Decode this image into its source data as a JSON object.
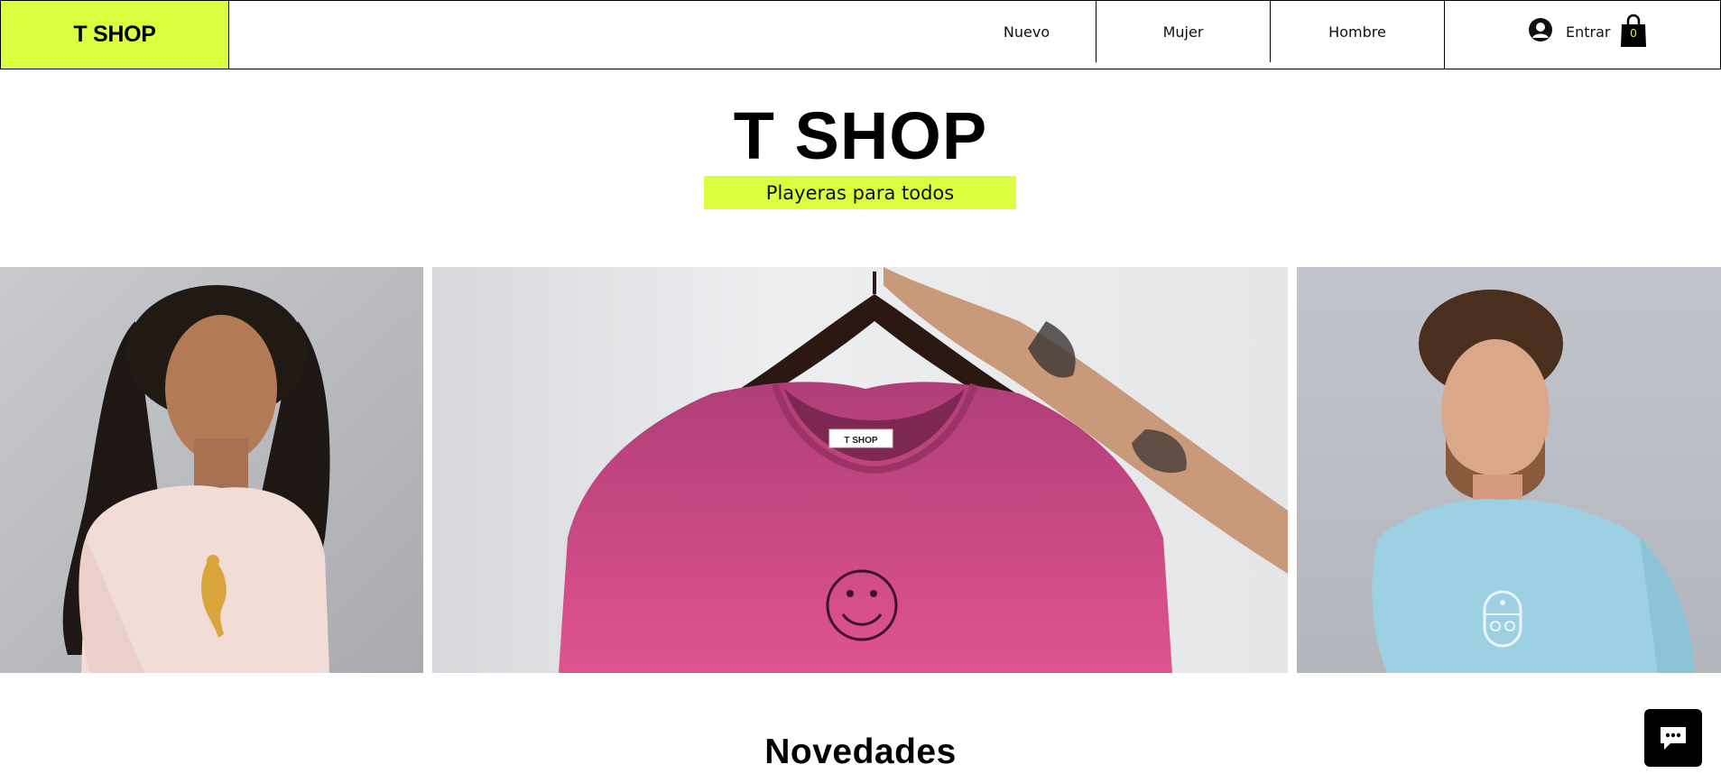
{
  "brand": {
    "logo_text": "T SHOP",
    "accent_color": "#dbff3f"
  },
  "nav": {
    "items": [
      {
        "label": "Nuevo"
      },
      {
        "label": "Mujer"
      },
      {
        "label": "Hombre"
      }
    ],
    "login_label": "Entrar",
    "login_icon": "user-avatar-icon",
    "cart_icon": "shopping-bag-icon",
    "cart_count": "0"
  },
  "hero": {
    "title": "T SHOP",
    "tagline": "Playeras para todos"
  },
  "gallery": {
    "center_shirt_label": "T SHOP"
  },
  "section": {
    "title": "Novedades"
  },
  "chat": {
    "icon": "chat-bubble-icon"
  }
}
